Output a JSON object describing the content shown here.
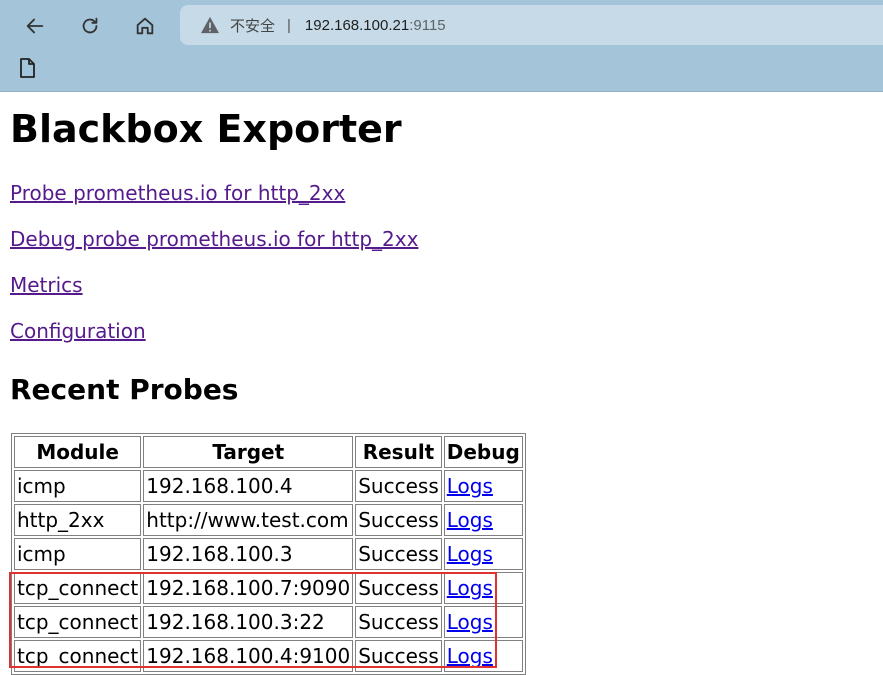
{
  "browser": {
    "address": {
      "security_label": "不安全",
      "separator": "|",
      "host": "192.168.100.21",
      "port": ":9115"
    }
  },
  "page": {
    "title": "Blackbox Exporter",
    "links": [
      "Probe prometheus.io for http_2xx",
      "Debug probe prometheus.io for http_2xx",
      "Metrics",
      "Configuration"
    ],
    "recent_probes_heading": "Recent Probes",
    "table": {
      "headers": [
        "Module",
        "Target",
        "Result",
        "Debug"
      ],
      "rows": [
        [
          "icmp",
          "192.168.100.4",
          "Success",
          "Logs"
        ],
        [
          "http_2xx",
          "http://www.test.com",
          "Success",
          "Logs"
        ],
        [
          "icmp",
          "192.168.100.3",
          "Success",
          "Logs"
        ],
        [
          "tcp_connect",
          "192.168.100.7:9090",
          "Success",
          "Logs"
        ],
        [
          "tcp_connect",
          "192.168.100.3:22",
          "Success",
          "Logs"
        ],
        [
          "tcp_connect",
          "192.168.100.4:9100",
          "Success",
          "Logs"
        ]
      ]
    }
  },
  "annotation": {
    "highlight_color": "#e03131"
  },
  "colors": {
    "visited_link": "#551a8b",
    "link": "#0000ee",
    "chrome_bg": "#a3c4d9"
  }
}
